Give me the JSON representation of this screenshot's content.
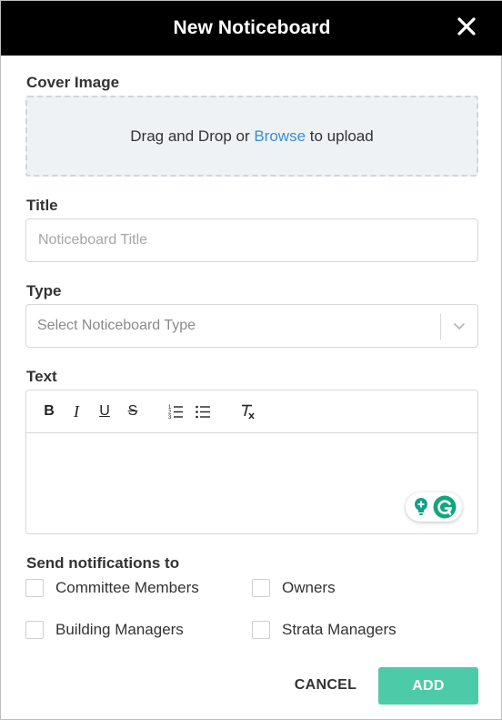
{
  "header": {
    "title": "New Noticeboard",
    "close_icon": "close-icon"
  },
  "cover_image": {
    "label": "Cover Image",
    "drop_text_before": "Drag and Drop or ",
    "browse_link": "Browse",
    "drop_text_after": " to upload"
  },
  "title_field": {
    "label": "Title",
    "placeholder": "Noticeboard Title",
    "value": ""
  },
  "type_field": {
    "label": "Type",
    "placeholder": "Select Noticeboard Type",
    "chevron_icon": "chevron-down-icon"
  },
  "text_field": {
    "label": "Text",
    "toolbar": {
      "bold": "B",
      "italic": "I",
      "underline": "U",
      "strike": "S"
    },
    "toolbar_icons": [
      "bold-icon",
      "italic-icon",
      "underline-icon",
      "strikethrough-icon",
      "ordered-list-icon",
      "bullet-list-icon",
      "clear-format-icon"
    ],
    "value": ""
  },
  "notifications": {
    "label": "Send notifications to",
    "options": [
      {
        "label": "Committee Members",
        "checked": false
      },
      {
        "label": "Owners",
        "checked": false
      },
      {
        "label": "Building Managers",
        "checked": false
      },
      {
        "label": "Strata Managers",
        "checked": false
      }
    ]
  },
  "footer": {
    "cancel_label": "CANCEL",
    "add_label": "ADD"
  },
  "colors": {
    "header_bg": "#000000",
    "accent": "#4dcba8",
    "link": "#3d8cd0",
    "dropzone_bg": "#eef2f5"
  }
}
